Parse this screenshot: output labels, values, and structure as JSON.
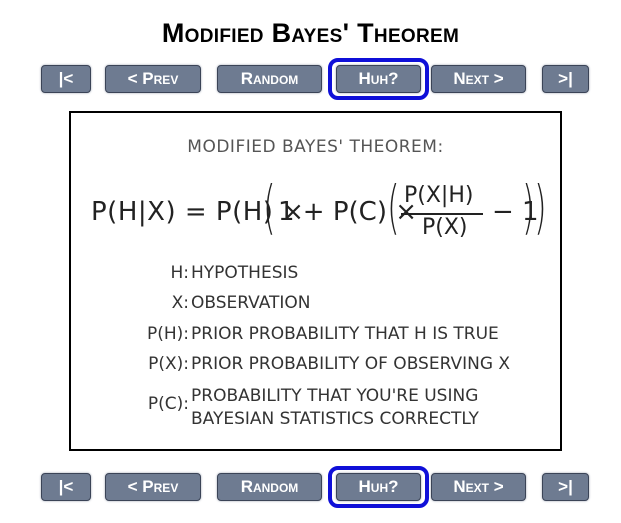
{
  "page": {
    "title": "Modified Bayes' Theorem"
  },
  "nav": {
    "first_label": "|<",
    "prev_label": "< Prev",
    "random_label": "Random",
    "huh_label": "Huh?",
    "next_label": "Next >",
    "last_label": ">|",
    "highlight_color": "#0f0fd8"
  },
  "comic": {
    "heading": "MODIFIED BAYES' THEOREM:",
    "formula": {
      "lhs": "P(H|X) = P(H) × ",
      "open_outer": "(",
      "inner": "1 + P(C) × ",
      "open_inner": "(",
      "numerator": "P(X|H)",
      "denominator": "P(X)",
      "minus_one": "− 1",
      "close_inner": ")",
      "close_outer": ")"
    },
    "definitions": [
      {
        "symbol": "H:",
        "description": "HYPOTHESIS"
      },
      {
        "symbol": "X:",
        "description": "OBSERVATION"
      },
      {
        "symbol": "P(H):",
        "description": "PRIOR PROBABILITY THAT H IS TRUE"
      },
      {
        "symbol": "P(X):",
        "description": "PRIOR PROBABILITY OF OBSERVING X"
      },
      {
        "symbol": "P(C):",
        "description": "PROBABILITY THAT YOU'RE USING"
      },
      {
        "symbol": "",
        "description": "BAYESIAN STATISTICS CORRECTLY"
      }
    ]
  }
}
